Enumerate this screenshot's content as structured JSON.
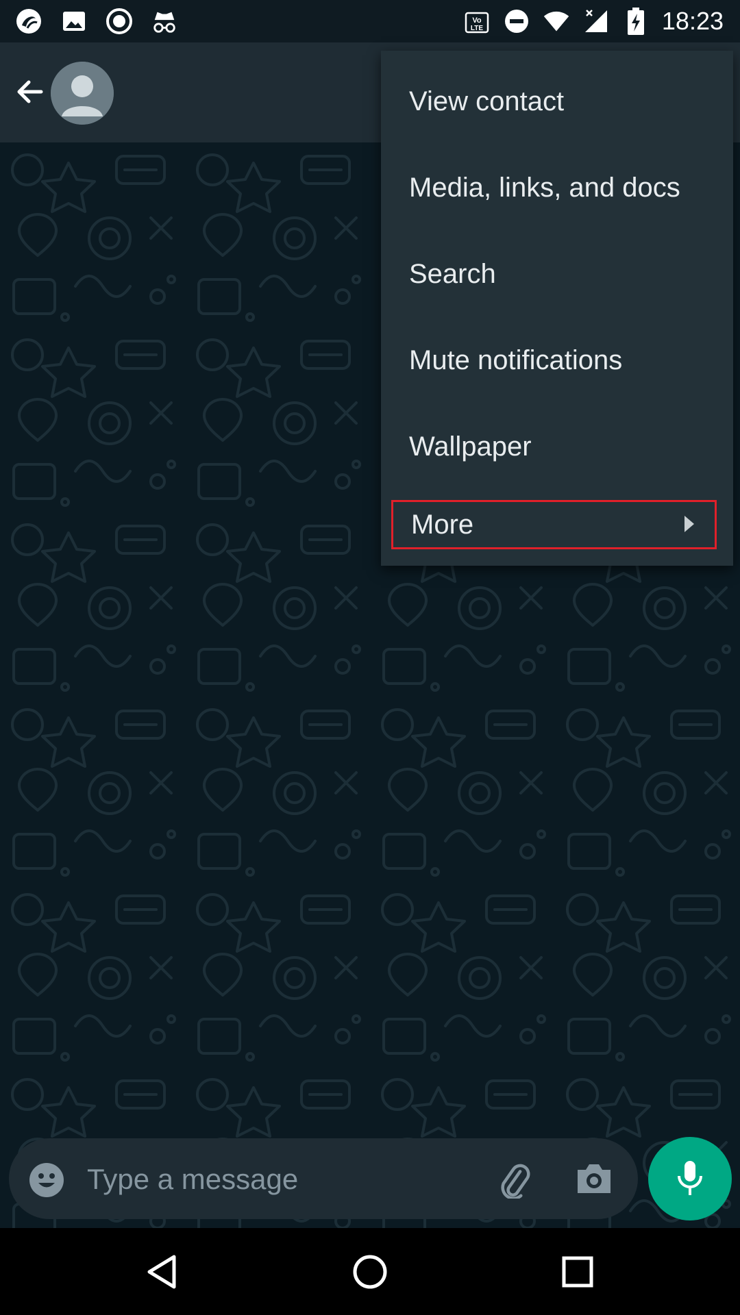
{
  "status_bar": {
    "time": "18:23",
    "left_icons": [
      "app-logo-icon",
      "image-icon",
      "record-icon",
      "incognito-icon"
    ],
    "right_icons": [
      "volte-icon",
      "do-not-disturb-icon",
      "wifi-icon",
      "signal-icon",
      "battery-charging-icon"
    ],
    "volte_label": "Vo LTE"
  },
  "app_bar": {
    "back_icon": "arrow-left-icon",
    "avatar_icon": "person-icon"
  },
  "menu": {
    "items": [
      {
        "label": "View contact"
      },
      {
        "label": "Media, links, and docs"
      },
      {
        "label": "Search"
      },
      {
        "label": "Mute notifications"
      },
      {
        "label": "Wallpaper"
      },
      {
        "label": "More",
        "has_submenu": true
      }
    ],
    "highlight_color": "#e0202a"
  },
  "composer": {
    "placeholder": "Type a message",
    "emoji_icon": "emoji-icon",
    "attach_icon": "paperclip-icon",
    "camera_icon": "camera-icon",
    "mic_icon": "microphone-icon",
    "mic_color": "#00a884"
  },
  "nav_bar": {
    "buttons": [
      "back-triangle-icon",
      "home-circle-icon",
      "recents-square-icon"
    ]
  }
}
